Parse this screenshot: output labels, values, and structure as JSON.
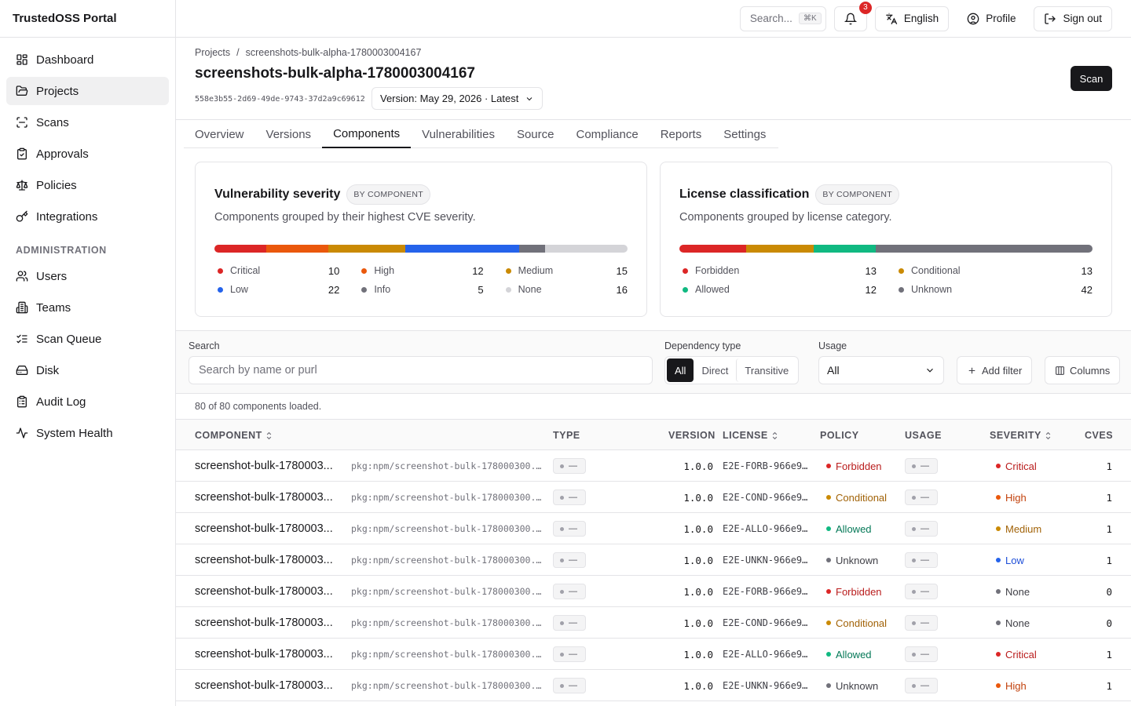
{
  "app": {
    "title": "TrustedOSS Portal"
  },
  "sidebar": {
    "items": [
      {
        "label": "Dashboard",
        "icon": "dashboard-icon"
      },
      {
        "label": "Projects",
        "icon": "folder-icon",
        "active": true
      },
      {
        "label": "Scans",
        "icon": "scan-icon"
      },
      {
        "label": "Approvals",
        "icon": "clipboard-check-icon"
      },
      {
        "label": "Policies",
        "icon": "scale-icon"
      },
      {
        "label": "Integrations",
        "icon": "key-icon"
      }
    ],
    "admin_heading": "ADMINISTRATION",
    "admin_items": [
      {
        "label": "Users",
        "icon": "users-icon"
      },
      {
        "label": "Teams",
        "icon": "building-icon"
      },
      {
        "label": "Scan Queue",
        "icon": "list-checks-icon"
      },
      {
        "label": "Disk",
        "icon": "hard-drive-icon"
      },
      {
        "label": "Audit Log",
        "icon": "clipboard-list-icon"
      },
      {
        "label": "System Health",
        "icon": "activity-icon"
      }
    ]
  },
  "topbar": {
    "search_label": "Search...",
    "search_shortcut": "⌘K",
    "notifications_count": "3",
    "language": "English",
    "profile": "Profile",
    "signout": "Sign out"
  },
  "header": {
    "breadcrumb_root": "Projects",
    "breadcrumb_sep": "/",
    "breadcrumb_current": "screenshots-bulk-alpha-1780003004167",
    "title": "screenshots-bulk-alpha-1780003004167",
    "uuid": "558e3b55-2d69-49de-9743-37d2a9c69612",
    "version": "Version: May 29, 2026 · Latest",
    "scan_label": "Scan"
  },
  "tabs": [
    "Overview",
    "Versions",
    "Components",
    "Vulnerabilities",
    "Source",
    "Compliance",
    "Reports",
    "Settings"
  ],
  "active_tab": "Components",
  "severity_card": {
    "title": "Vulnerability severity",
    "pill": "BY COMPONENT",
    "subtitle": "Components grouped by their highest CVE severity.",
    "items": [
      {
        "label": "Critical",
        "count": "10",
        "value": 10,
        "color": "#dc2626"
      },
      {
        "label": "High",
        "count": "12",
        "value": 12,
        "color": "#ea580c"
      },
      {
        "label": "Medium",
        "count": "15",
        "value": 15,
        "color": "#ca8a04"
      },
      {
        "label": "Low",
        "count": "22",
        "value": 22,
        "color": "#2563eb"
      },
      {
        "label": "Info",
        "count": "5",
        "value": 5,
        "color": "#71717a"
      },
      {
        "label": "None",
        "count": "16",
        "value": 16,
        "color": "#d4d4d8"
      }
    ]
  },
  "license_card": {
    "title": "License classification",
    "pill": "BY COMPONENT",
    "subtitle": "Components grouped by license category.",
    "items": [
      {
        "label": "Forbidden",
        "count": "13",
        "value": 13,
        "color": "#dc2626"
      },
      {
        "label": "Conditional",
        "count": "13",
        "value": 13,
        "color": "#ca8a04"
      },
      {
        "label": "Allowed",
        "count": "12",
        "value": 12,
        "color": "#10b981"
      },
      {
        "label": "Unknown",
        "count": "42",
        "value": 42,
        "color": "#71717a"
      }
    ]
  },
  "filters": {
    "search_label": "Search",
    "search_placeholder": "Search by name or purl",
    "dep_label": "Dependency type",
    "dep_options": [
      "All",
      "Direct",
      "Transitive"
    ],
    "dep_selected": "All",
    "usage_label": "Usage",
    "usage_value": "All",
    "add_filter": "Add filter",
    "columns": "Columns"
  },
  "loaded_text": "80 of 80 components loaded.",
  "table": {
    "headers": {
      "component": "COMPONENT",
      "type": "TYPE",
      "version": "VERSION",
      "license": "LICENSE",
      "policy": "POLICY",
      "usage": "USAGE",
      "severity": "SEVERITY",
      "cves": "CVES"
    },
    "rows": [
      {
        "name": "screenshot-bulk-1780003...",
        "purl": "pkg:npm/screenshot-bulk-178000300...",
        "type": "—",
        "version": "1.0.0",
        "license": "E2E-FORB-966e9...",
        "policy": "Forbidden",
        "usage": "—",
        "severity": "Critical",
        "cves": "1"
      },
      {
        "name": "screenshot-bulk-1780003...",
        "purl": "pkg:npm/screenshot-bulk-178000300...",
        "type": "—",
        "version": "1.0.0",
        "license": "E2E-COND-966e9...",
        "policy": "Conditional",
        "usage": "—",
        "severity": "High",
        "cves": "1"
      },
      {
        "name": "screenshot-bulk-1780003...",
        "purl": "pkg:npm/screenshot-bulk-178000300...",
        "type": "—",
        "version": "1.0.0",
        "license": "E2E-ALLO-966e9...",
        "policy": "Allowed",
        "usage": "—",
        "severity": "Medium",
        "cves": "1"
      },
      {
        "name": "screenshot-bulk-1780003...",
        "purl": "pkg:npm/screenshot-bulk-178000300...",
        "type": "—",
        "version": "1.0.0",
        "license": "E2E-UNKN-966e9...",
        "policy": "Unknown",
        "usage": "—",
        "severity": "Low",
        "cves": "1"
      },
      {
        "name": "screenshot-bulk-1780003...",
        "purl": "pkg:npm/screenshot-bulk-178000300...",
        "type": "—",
        "version": "1.0.0",
        "license": "E2E-FORB-966e9...",
        "policy": "Forbidden",
        "usage": "—",
        "severity": "None",
        "cves": "0"
      },
      {
        "name": "screenshot-bulk-1780003...",
        "purl": "pkg:npm/screenshot-bulk-178000300...",
        "type": "—",
        "version": "1.0.0",
        "license": "E2E-COND-966e9...",
        "policy": "Conditional",
        "usage": "—",
        "severity": "None",
        "cves": "0"
      },
      {
        "name": "screenshot-bulk-1780003...",
        "purl": "pkg:npm/screenshot-bulk-178000300...",
        "type": "—",
        "version": "1.0.0",
        "license": "E2E-ALLO-966e9...",
        "policy": "Allowed",
        "usage": "—",
        "severity": "Critical",
        "cves": "1"
      },
      {
        "name": "screenshot-bulk-1780003...",
        "purl": "pkg:npm/screenshot-bulk-178000300...",
        "type": "—",
        "version": "1.0.0",
        "license": "E2E-UNKN-966e9...",
        "policy": "Unknown",
        "usage": "—",
        "severity": "High",
        "cves": "1"
      }
    ]
  },
  "colors": {
    "policy": {
      "Forbidden": "#dc2626",
      "Conditional": "#ca8a04",
      "Allowed": "#10b981",
      "Unknown": "#71717a"
    },
    "policy_text": {
      "Forbidden": "#b91c1c",
      "Conditional": "#a16207",
      "Allowed": "#047857",
      "Unknown": "#3f3f46"
    },
    "severity": {
      "Critical": "#dc2626",
      "High": "#ea580c",
      "Medium": "#ca8a04",
      "Low": "#2563eb",
      "None": "#71717a"
    },
    "severity_text": {
      "Critical": "#b91c1c",
      "High": "#c2410c",
      "Medium": "#a16207",
      "Low": "#1d4ed8",
      "None": "#3f3f46"
    }
  }
}
